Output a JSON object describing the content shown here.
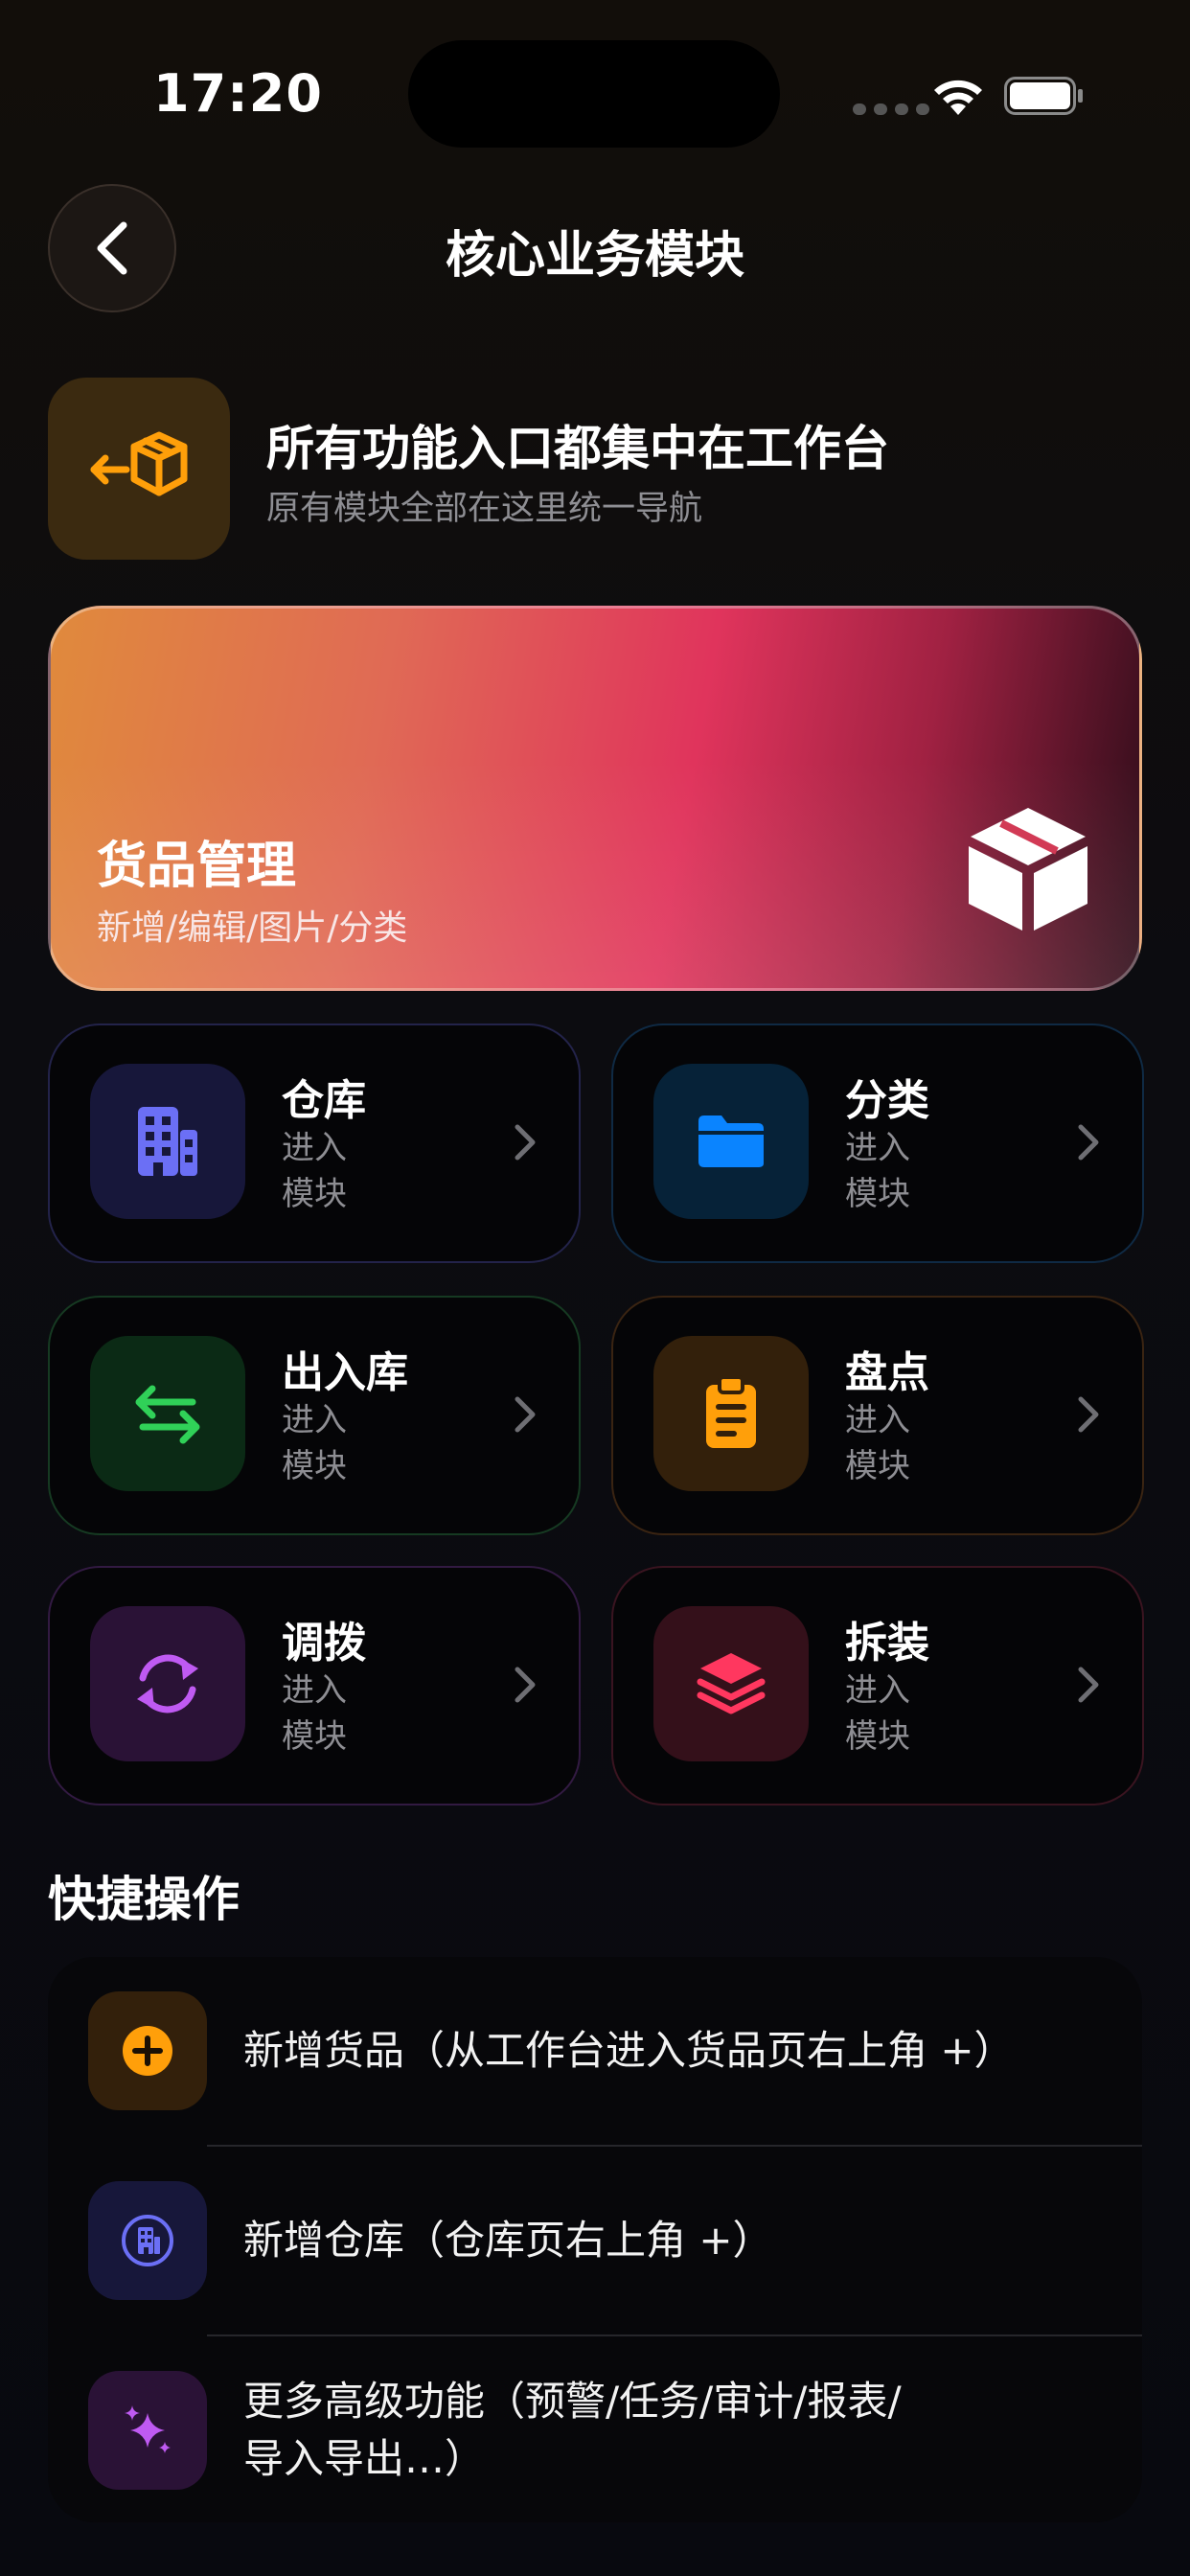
{
  "status_bar": {
    "time": "17:20"
  },
  "nav": {
    "title": "核心业务模块"
  },
  "hero": {
    "title": "所有功能入口都集中在工作台",
    "subtitle": "原有模块全部在这里统一导航"
  },
  "feature_card": {
    "title": "货品管理",
    "subtitle": "新增/编辑/图片/分类"
  },
  "modules": [
    {
      "name": "仓库",
      "desc_line1": "进入",
      "desc_line2": "模块",
      "icon": "building-icon",
      "accent": "#6b6ff5"
    },
    {
      "name": "分类",
      "desc_line1": "进入",
      "desc_line2": "模块",
      "icon": "folder-icon",
      "accent": "#0a84ff"
    },
    {
      "name": "出入库",
      "desc_line1": "进入",
      "desc_line2": "模块",
      "icon": "transfer-arrows-icon",
      "accent": "#30d158"
    },
    {
      "name": "盘点",
      "desc_line1": "进入",
      "desc_line2": "模块",
      "icon": "clipboard-icon",
      "accent": "#ff9f0a"
    },
    {
      "name": "调拨",
      "desc_line1": "进入",
      "desc_line2": "模块",
      "icon": "sync-icon",
      "accent": "#bf5af2"
    },
    {
      "name": "拆装",
      "desc_line1": "进入",
      "desc_line2": "模块",
      "icon": "layers-icon",
      "accent": "#ff375f"
    }
  ],
  "quick_actions": {
    "title": "快捷操作",
    "items": [
      {
        "line1": "新增货品（从工作台进入货品页右上角 +）",
        "line2": "",
        "icon": "plus-circle-icon"
      },
      {
        "line1": "新增仓库（仓库页右上角 +）",
        "line2": "",
        "icon": "building-circle-icon"
      },
      {
        "line1": "更多高级功能（预警/任务/审计/报表/",
        "line2": "导入导出…）",
        "icon": "sparkles-icon"
      }
    ]
  }
}
